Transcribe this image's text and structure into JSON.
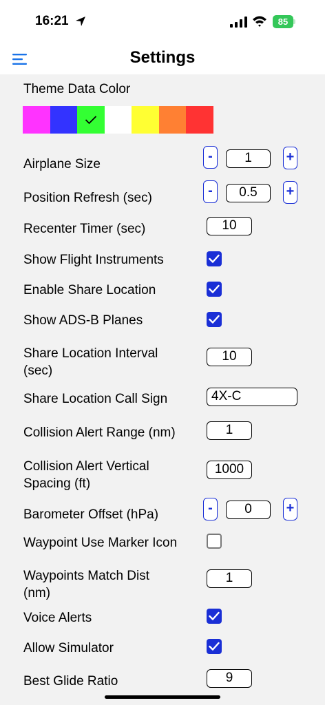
{
  "status": {
    "time": "16:21",
    "battery": "85"
  },
  "nav": {
    "title": "Settings"
  },
  "theme": {
    "label": "Theme Data Color",
    "colors": [
      "#ff33ff",
      "#3333ff",
      "#33ff33",
      "#ffffff",
      "#ffff33",
      "#ff8033",
      "#ff3333"
    ],
    "selected_index": 2
  },
  "settings": {
    "airplane_size": {
      "label": "Airplane Size",
      "value": "1",
      "minus": "-",
      "plus": "+"
    },
    "position_refresh": {
      "label": "Position Refresh (sec)",
      "value": "0.5",
      "minus": "-",
      "plus": "+"
    },
    "recenter_timer": {
      "label": "Recenter Timer (sec)",
      "value": "10"
    },
    "show_flight_instruments": {
      "label": "Show Flight Instruments",
      "checked": true
    },
    "enable_share_location": {
      "label": "Enable Share Location",
      "checked": true
    },
    "show_adsb_planes": {
      "label": "Show ADS-B Planes",
      "checked": true
    },
    "share_location_interval": {
      "label_line1": "Share Location Interval",
      "label_line2": "(sec)",
      "value": "10"
    },
    "share_location_call_sign": {
      "label": "Share Location Call Sign",
      "value": "4X-C"
    },
    "collision_alert_range": {
      "label": "Collision Alert Range (nm)",
      "value": "1"
    },
    "collision_alert_vertical": {
      "label_line1": "Collision Alert Vertical",
      "label_line2": "Spacing (ft)",
      "value": "1000"
    },
    "barometer_offset": {
      "label": "Barometer Offset (hPa)",
      "value": "0",
      "minus": "-",
      "plus": "+"
    },
    "waypoint_use_marker_icon": {
      "label": "Waypoint Use Marker Icon",
      "checked": false
    },
    "waypoints_match_dist": {
      "label_line1": "Waypoints Match Dist",
      "label_line2": "(nm)",
      "value": "1"
    },
    "voice_alerts": {
      "label": "Voice Alerts",
      "checked": true
    },
    "allow_simulator": {
      "label": "Allow Simulator",
      "checked": true
    },
    "best_glide_ratio": {
      "label": "Best Glide Ratio",
      "value": "9"
    }
  }
}
